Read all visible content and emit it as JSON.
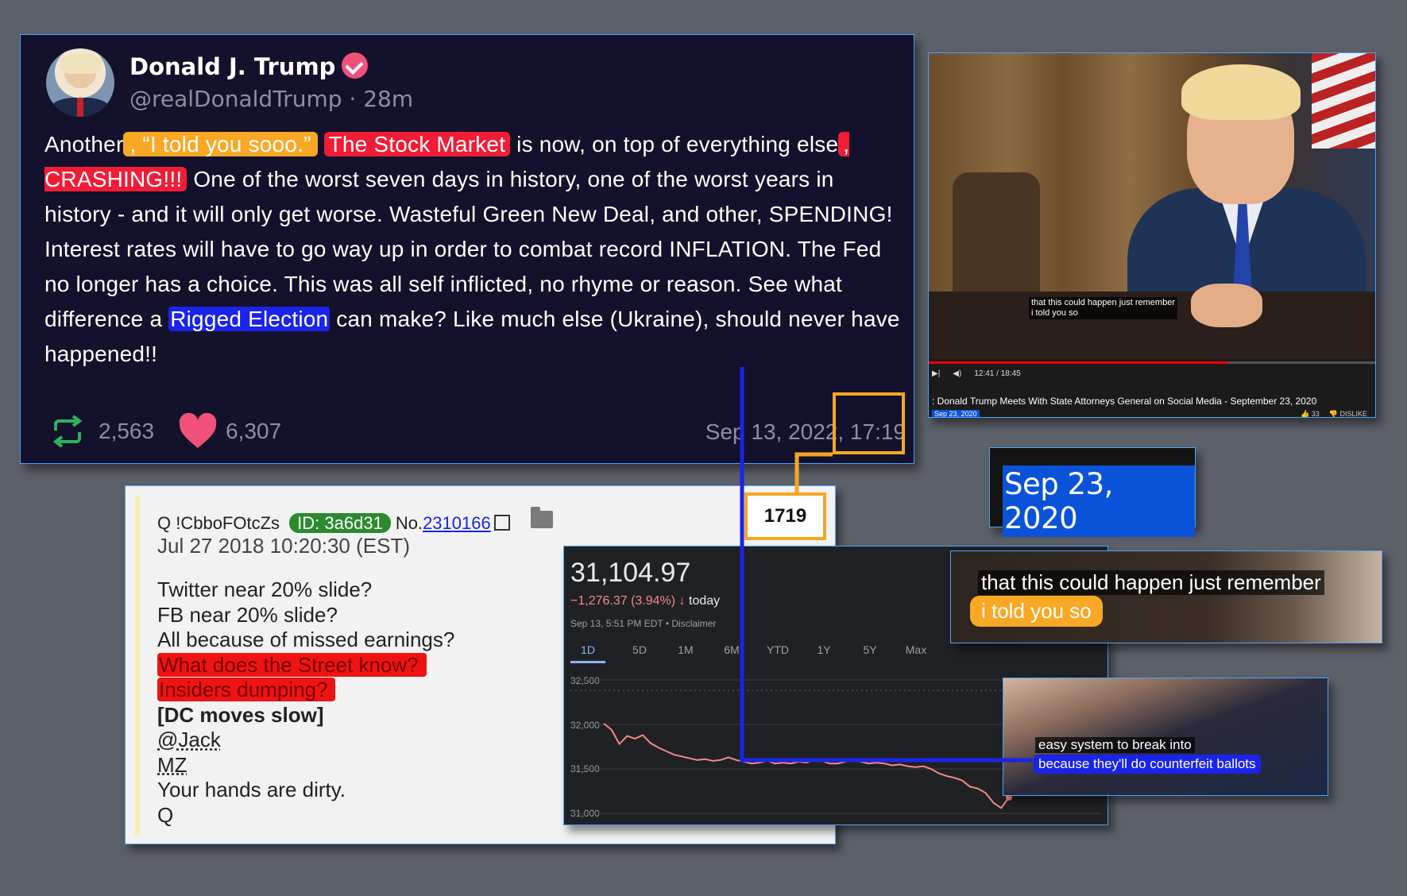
{
  "tweet": {
    "name": "Donald J. Trump",
    "handle": "@realDonaldTrump · 28m",
    "body": {
      "p1": "Another",
      "hl_told": ", “I told you sooo.”",
      "hl_market": "The Stock Market",
      "p2": " is now, on top of everything else",
      "hl_crash": ", CRASHING!!!",
      "p3": " One of the worst seven days in history, one of the worst years in history - and it will only get worse. Wasteful Green New Deal, and other, SPENDING! Interest rates will have to go way up in order to combat record INFLATION. The Fed no longer has a choice. This was all self inflicted, no rhyme or reason. See what difference a ",
      "hl_rigged": "Rigged Election",
      "p4": " can make? Like much else (Ukraine), should never have happened!!"
    },
    "retweets": "2,563",
    "likes": "6,307",
    "date": "Sep 13, 2022, 17:19",
    "colors": {
      "orange": "#f9a826",
      "red": "#f11c36",
      "blue": "#1a24e8",
      "verified": "#f0507a"
    }
  },
  "annotation_label": "1719",
  "qpost": {
    "author": "Q !CbboFOtcZs",
    "id": "ID: 3a6d31",
    "no_label": "No.",
    "number": "2310166",
    "date": "Jul 27 2018 10:20:30 (EST)",
    "lines": {
      "l1": "Twitter near 20% slide?",
      "l2": "FB near 20% slide?",
      "l3": "All because of missed earnings?",
      "l4": "What does the Street know?",
      "l5": "Insiders dumping?",
      "l6": "[DC moves slow]",
      "l7": "@Jack",
      "l8": "MZ",
      "l9": "Your hands are dirty.",
      "l10": "Q"
    }
  },
  "stock": {
    "price": "31,104.97",
    "change": "−1,276.37 (3.94%)",
    "change_arrow": "↓",
    "change_suffix": "today",
    "meta": "Sep 13, 5:51 PM EDT • Disclaimer",
    "tabs": [
      "1D",
      "5D",
      "1M",
      "6M",
      "YTD",
      "1Y",
      "5Y",
      "Max"
    ],
    "active_tab": "1D",
    "line_color": "#f28b82"
  },
  "chart_data": {
    "type": "line",
    "title": "",
    "xlabel": "",
    "ylabel": "",
    "y_ticks": [
      "32,500",
      "32,000",
      "31,500",
      "31,000"
    ],
    "ylim": [
      31000,
      32500
    ],
    "previous_close": 32381.34,
    "series": [
      {
        "values": [
          32010,
          31940,
          31780,
          31870,
          31840,
          31880,
          31790,
          31740,
          31700,
          31660,
          31640,
          31620,
          31600,
          31610,
          31590,
          31600,
          31630,
          31600,
          31580,
          31560,
          31570,
          31590,
          31560,
          31570,
          31560,
          31580,
          31570,
          31600,
          31590,
          31560,
          31560,
          31580,
          31600,
          31580,
          31560,
          31570,
          31560,
          31540,
          31550,
          31530,
          31520,
          31530,
          31500,
          31450,
          31420,
          31400,
          31370,
          31300,
          31280,
          31230,
          31120,
          31060,
          31180
        ]
      }
    ]
  },
  "video": {
    "subtitle_l1": "that this could happen just remember",
    "subtitle_l2": "i told you so",
    "time": "12:41 / 18:45",
    "title": ": Donald Trump Meets With State Attorneys General on Social Media - September 23, 2020",
    "date": "Sep 23, 2020",
    "likes": "33",
    "dislike": "DISLIKE"
  },
  "date_zoom": "Sep 23, 2020",
  "sub_zoom_1": {
    "line1": "that this could happen just remember",
    "line2": "i told you so"
  },
  "sub_zoom_2": {
    "line1": "easy system to break into",
    "line2": "because they'll do counterfeit ballots"
  }
}
